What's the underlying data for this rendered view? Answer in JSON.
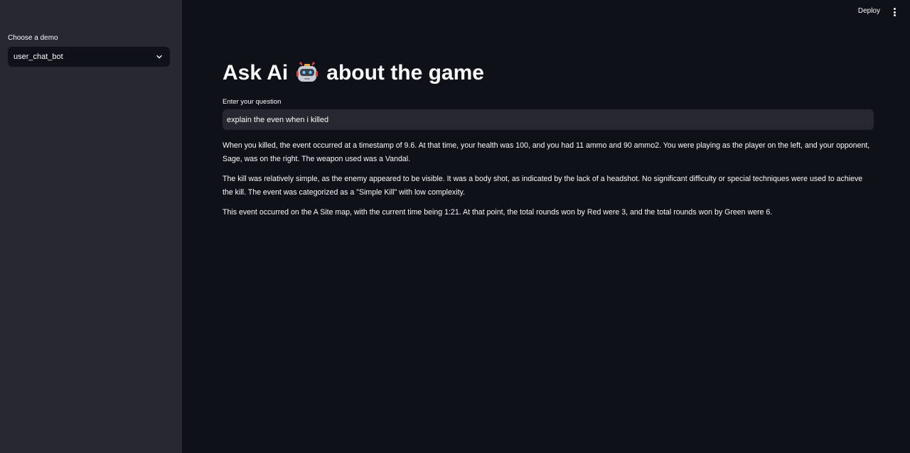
{
  "sidebar": {
    "label": "Choose a demo",
    "selected": "user_chat_bot"
  },
  "header": {
    "deploy_label": "Deploy"
  },
  "main": {
    "title_before": "Ask Ai",
    "title_after": "about the game",
    "input_label": "Enter your question",
    "input_value": "explain the even when i killed",
    "paragraphs": [
      "When you killed, the event occurred at a timestamp of 9.6. At that time, your health was 100, and you had 11 ammo and 90 ammo2. You were playing as the player on the left, and your opponent, Sage, was on the right. The weapon used was a Vandal.",
      "The kill was relatively simple, as the enemy appeared to be visible. It was a body shot, as indicated by the lack of a headshot. No significant difficulty or special techniques were used to achieve the kill. The event was categorized as a \"Simple Kill\" with low complexity.",
      "This event occurred on the A Site map, with the current time being 1:21. At that point, the total rounds won by Red were 3, and the total rounds won by Green were 6."
    ]
  },
  "icons": {
    "title_icon": "robot-icon",
    "select_icon": "chevron-down-icon",
    "header_menu_icon": "more-vertical-icon"
  },
  "colors": {
    "background": "#0e1117",
    "sidebar": "#262730",
    "text": "#fafafa"
  }
}
